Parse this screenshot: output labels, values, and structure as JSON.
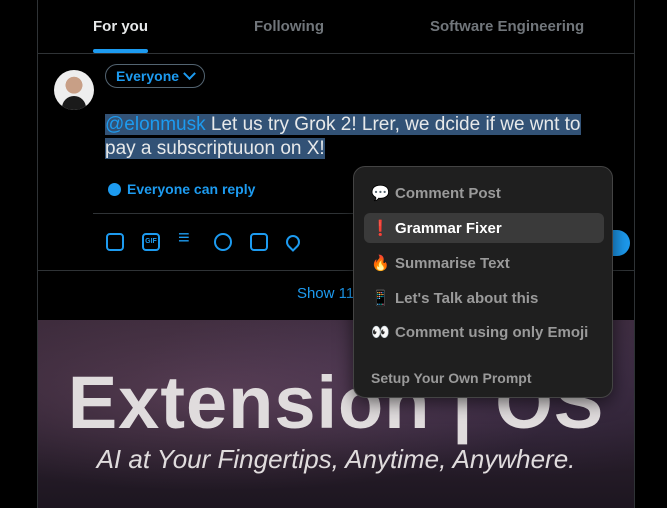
{
  "tabs": [
    {
      "label": "For you",
      "active": true
    },
    {
      "label": "Following",
      "active": false
    },
    {
      "label": "Software Engineering",
      "active": false
    }
  ],
  "composer": {
    "audience": "Everyone",
    "mention": "@elonmusk",
    "text_line1": " Let us try Grok 2! Lrer, we dcide if we wnt to",
    "text_line2": "pay a subscriptuuon on X!",
    "reply_setting": "Everyone can reply",
    "toolbar_icons": [
      "image-icon",
      "gif-icon",
      "poll-icon",
      "emoji-icon",
      "schedule-icon",
      "location-icon"
    ]
  },
  "timeline": {
    "show_more": "Show 114 p"
  },
  "banner": {
    "title": "Extension | OS",
    "subtitle": "AI at Your Fingertips, Anytime, Anywhere."
  },
  "menu": {
    "items": [
      {
        "emoji": "💬",
        "label": "Comment Post",
        "active": false
      },
      {
        "emoji": "❗",
        "label": "Grammar Fixer",
        "active": true
      },
      {
        "emoji": "🔥",
        "label": "Summarise Text",
        "active": false
      },
      {
        "emoji": "📱",
        "label": "Let's Talk about this",
        "active": false
      },
      {
        "emoji": "👀",
        "label": "Comment using only Emoji",
        "active": false
      }
    ],
    "setup_label": "Setup Your Own Prompt"
  },
  "colors": {
    "accent": "#1d9bf0",
    "background": "#000000",
    "menu_bg": "#1f1f1f"
  }
}
